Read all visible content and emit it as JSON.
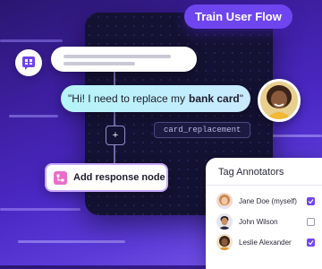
{
  "title": "Train User Flow",
  "user_message": {
    "prefix": "\"Hi! I need to replace my",
    "highlight": "bank card",
    "suffix": "\""
  },
  "variable_tag": "card_replacement",
  "add_node_label": "Add response node",
  "plus_symbol": "+",
  "tag_panel": {
    "title": "Tag Annotators",
    "annotators": [
      {
        "name": "Jane Doe (myself)",
        "checked": true
      },
      {
        "name": "John Wilson",
        "checked": false
      },
      {
        "name": "Leslie Alexander",
        "checked": true
      }
    ]
  },
  "colors": {
    "accent": "#6f45f0",
    "bubble": "#b5f4f7",
    "canvas": "#141233",
    "node_icon": "#e96fc9"
  },
  "icons": {
    "app": "chat-grid-icon",
    "node": "flow-node-icon",
    "checkbox_checked": "check-icon"
  }
}
